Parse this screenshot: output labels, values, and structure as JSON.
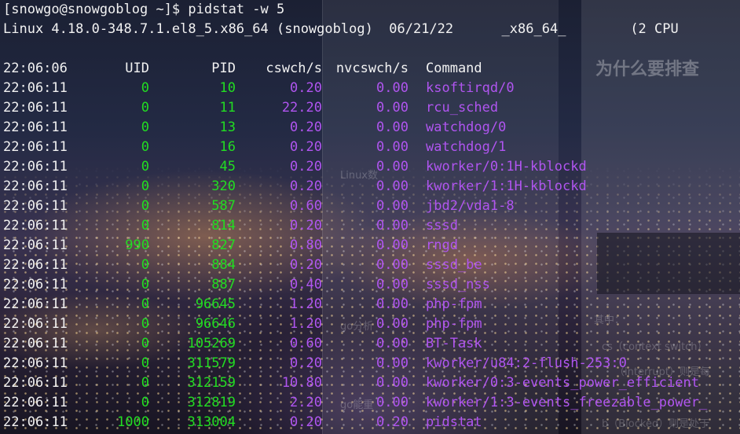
{
  "terminal": {
    "prompt": "[snowgo@snowgoblog ~]$ pidstat -w 5",
    "sysinfo": "Linux 4.18.0-348.7.1.el8_5.x86_64 (snowgoblog)  06/21/22      _x86_64_        (2 CPU",
    "header": {
      "time": "22:06:06",
      "uid": "UID",
      "pid": "PID",
      "cswch": "cswch/s",
      "nvcswch": "nvcswch/s",
      "command": "Command"
    },
    "rows": [
      {
        "time": "22:06:11",
        "uid": "0",
        "pid": "10",
        "cswch": "0.20",
        "nvcswch": "0.00",
        "command": "ksoftirqd/0"
      },
      {
        "time": "22:06:11",
        "uid": "0",
        "pid": "11",
        "cswch": "22.20",
        "nvcswch": "0.00",
        "command": "rcu_sched"
      },
      {
        "time": "22:06:11",
        "uid": "0",
        "pid": "13",
        "cswch": "0.20",
        "nvcswch": "0.00",
        "command": "watchdog/0"
      },
      {
        "time": "22:06:11",
        "uid": "0",
        "pid": "16",
        "cswch": "0.20",
        "nvcswch": "0.00",
        "command": "watchdog/1"
      },
      {
        "time": "22:06:11",
        "uid": "0",
        "pid": "45",
        "cswch": "0.20",
        "nvcswch": "0.00",
        "command": "kworker/0:1H-kblockd"
      },
      {
        "time": "22:06:11",
        "uid": "0",
        "pid": "320",
        "cswch": "0.20",
        "nvcswch": "0.00",
        "command": "kworker/1:1H-kblockd"
      },
      {
        "time": "22:06:11",
        "uid": "0",
        "pid": "587",
        "cswch": "0.60",
        "nvcswch": "0.00",
        "command": "jbd2/vda1-8"
      },
      {
        "time": "22:06:11",
        "uid": "0",
        "pid": "814",
        "cswch": "0.20",
        "nvcswch": "0.00",
        "command": "sssd"
      },
      {
        "time": "22:06:11",
        "uid": "990",
        "pid": "827",
        "cswch": "0.80",
        "nvcswch": "0.00",
        "command": "rngd"
      },
      {
        "time": "22:06:11",
        "uid": "0",
        "pid": "884",
        "cswch": "0.20",
        "nvcswch": "0.00",
        "command": "sssd_be"
      },
      {
        "time": "22:06:11",
        "uid": "0",
        "pid": "887",
        "cswch": "0.40",
        "nvcswch": "0.00",
        "command": "sssd_nss"
      },
      {
        "time": "22:06:11",
        "uid": "0",
        "pid": "96645",
        "cswch": "1.20",
        "nvcswch": "0.00",
        "command": "php-fpm"
      },
      {
        "time": "22:06:11",
        "uid": "0",
        "pid": "96646",
        "cswch": "1.20",
        "nvcswch": "0.00",
        "command": "php-fpm"
      },
      {
        "time": "22:06:11",
        "uid": "0",
        "pid": "105269",
        "cswch": "0.60",
        "nvcswch": "0.00",
        "command": "BT-Task"
      },
      {
        "time": "22:06:11",
        "uid": "0",
        "pid": "311579",
        "cswch": "0.20",
        "nvcswch": "0.00",
        "command": "kworker/u84:2-flush-253:0"
      },
      {
        "time": "22:06:11",
        "uid": "0",
        "pid": "312159",
        "cswch": "10.80",
        "nvcswch": "0.00",
        "command": "kworker/0:3-events_power_efficient"
      },
      {
        "time": "22:06:11",
        "uid": "0",
        "pid": "312819",
        "cswch": "2.20",
        "nvcswch": "0.00",
        "command": "kworker/1:3-events_freezable_power_"
      },
      {
        "time": "22:06:11",
        "uid": "1000",
        "pid": "313004",
        "cswch": "0.20",
        "nvcswch": "0.20",
        "command": "pidstat"
      }
    ]
  },
  "background": {
    "heading": "为什么要排查",
    "snippets": [
      "go分析",
      "go能重",
      "Linux数",
      "其中：",
      "cs（context switch）",
      "（interrupt）则是每",
      "b（Blocked）则是处于"
    ]
  },
  "colors": {
    "text": "#f2f2f2",
    "uid_pid": "#22dd22",
    "stats_command": "#b055f0"
  }
}
